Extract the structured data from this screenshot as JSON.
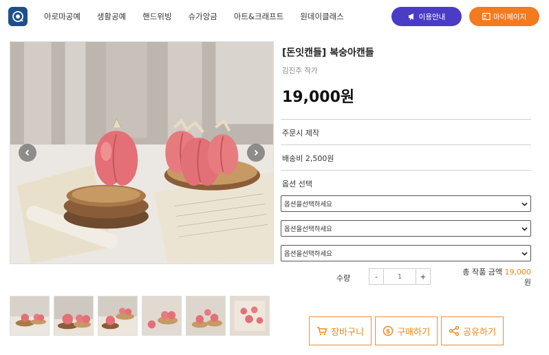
{
  "header": {
    "nav": [
      "아로마공예",
      "생활공예",
      "핸드위빙",
      "슈가앙금",
      "아트&크래프트",
      "원데이클래스"
    ],
    "guide_label": "이용안내",
    "mypage_label": "마이페이지",
    "guide_color": "#4b3cc6",
    "mypage_color": "#f47a20"
  },
  "product": {
    "title": "[돈잇캔들] 복숭아캔들",
    "artist": "김진주 작가",
    "price": "19,000원",
    "made_to_order": "주문시 제작",
    "shipping": "배송비 2,500원",
    "option_heading": "옵션 선택",
    "options": [
      "옵션을선택하세요",
      "옵션을선택하세요",
      "옵션을선택하세요"
    ],
    "quantity_label": "수량",
    "quantity_value": "1",
    "minus_label": "-",
    "plus_label": "+",
    "total_label": "총 작품 금액",
    "total_amount": "19,000",
    "total_unit": "원",
    "accent_color": "#f0861a"
  },
  "actions": {
    "cart_label": "장바구니",
    "buy_label": "구매하기",
    "share_label": "공유하기"
  },
  "gallery": {
    "thumbnail_count": 6,
    "icons": [
      "peach-candle-photo"
    ]
  }
}
